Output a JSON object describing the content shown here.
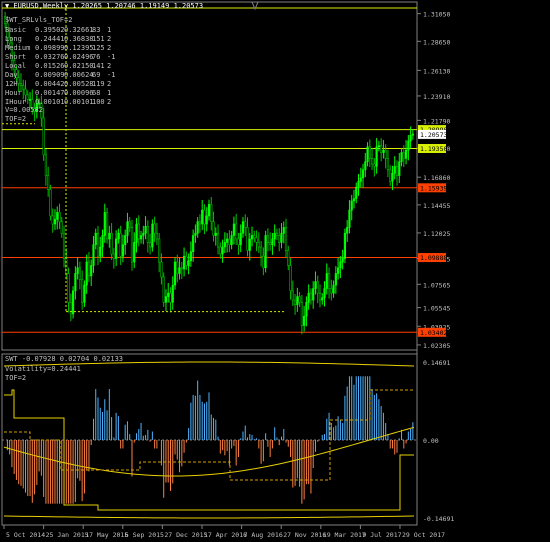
{
  "header": {
    "symbol_line": "▼ EURUSD,Weekly  1.20265 1.20746 1.19149 1.20573",
    "indicator_name": "SWT_SRLvls_TOF=2"
  },
  "stats_table": {
    "rows": [
      {
        "name": "Basic",
        "v1": "0.39502",
        "v2": "0.32661",
        "v3": "83",
        "v4": "1"
      },
      {
        "name": "Long",
        "v1": "0.24441",
        "v2": "0.36838",
        "v3": "151",
        "v4": "2"
      },
      {
        "name": "Medium",
        "v1": "0.09899",
        "v2": "0.12395",
        "v3": "125",
        "v4": "2"
      },
      {
        "name": "Short",
        "v1": "0.03276",
        "v3": "76",
        "v2": "0.02496",
        "v4": "-1"
      },
      {
        "name": "Local",
        "v1": "0.01526",
        "v2": "0.02150",
        "v3": "141",
        "v4": "2"
      },
      {
        "name": "Day",
        "v1": "0.00909",
        "v2": "0.00624",
        "v3": "69",
        "v4": "-1"
      },
      {
        "name": "12H",
        "v1": "0.00442",
        "v2": "0.00528",
        "v3": "119",
        "v4": "2"
      },
      {
        "name": "Hour",
        "v1": "0.00147",
        "v2": "0.00096",
        "v3": "68",
        "v4": "1"
      },
      {
        "name": "IHour",
        "v1": "0.00101",
        "v2": "0.00101",
        "v3": "100",
        "v4": "2"
      }
    ],
    "v_line": "V=0.00582",
    "tof_line": "TOF=2"
  },
  "price_axis": {
    "labels": [
      "1.31050",
      "1.28650",
      "1.26130",
      "1.23910",
      "1.21790",
      "1.19380",
      "1.16860",
      "1.14455",
      "1.12025",
      "1.09805",
      "1.07565",
      "1.05545",
      "1.03925",
      "1.02305"
    ],
    "highlight_labels": [
      {
        "text": "1.20990",
        "color": "#d8f000",
        "text_color": "#000000"
      },
      {
        "text": "1.20573",
        "color": "#ffffff",
        "text_color": "#000000"
      },
      {
        "text": "1.19350",
        "color": "#d8f000",
        "text_color": "#000000"
      },
      {
        "text": "1.15939",
        "color": "#ff4000",
        "text_color": "#000000"
      },
      {
        "text": "1.09888",
        "color": "#ff4000",
        "text_color": "#000000"
      },
      {
        "text": "1.03402",
        "color": "#ff4000",
        "text_color": "#000000"
      }
    ]
  },
  "sub_window": {
    "title": "SWT -0.07928 0.02704 0.02133",
    "volatility": "Volatility=0.24441",
    "tof": "TOF=2",
    "axis_labels": [
      "0.14691",
      "0.00",
      "-0.14691"
    ]
  },
  "time_axis": {
    "labels": [
      "5 Oct 2014",
      "25 Jan 2015",
      "17 May 2015",
      "6 Sep 2015",
      "27 Dec 2015",
      "17 Apr 2016",
      "7 Aug 2016",
      "27 Nov 2016",
      "19 Mar 2017",
      "9 Jul 2017",
      "29 Oct 2017"
    ]
  },
  "colors": {
    "background": "#000000",
    "bull_candle": "#00ff00",
    "bear_candle": "#00c000",
    "support": "#ff4000",
    "resistance": "#d8f000",
    "grid_text": "#c0c0c0",
    "histogram_up": "#4fb4ff",
    "histogram_down": "#ff8040",
    "envelope": "#e8d000"
  },
  "chart_data": {
    "type": "candlestick",
    "symbol": "EURUSD",
    "timeframe": "Weekly",
    "ylim": [
      1.023,
      1.318
    ],
    "levels": [
      1.2099,
      1.1935,
      1.15939,
      1.09888,
      1.03402
    ],
    "closes": [
      1.302,
      1.29,
      1.285,
      1.27,
      1.262,
      1.255,
      1.25,
      1.248,
      1.245,
      1.24,
      1.236,
      1.236,
      1.228,
      1.226,
      1.232,
      1.233,
      1.22,
      1.188,
      1.17,
      1.158,
      1.135,
      1.128,
      1.132,
      1.138,
      1.13,
      1.12,
      1.098,
      1.085,
      1.06,
      1.05,
      1.07,
      1.085,
      1.09,
      1.08,
      1.06,
      1.075,
      1.095,
      1.083,
      1.092,
      1.11,
      1.12,
      1.1,
      1.108,
      1.118,
      1.138,
      1.115,
      1.12,
      1.102,
      1.098,
      1.115,
      1.12,
      1.1,
      1.11,
      1.118,
      1.13,
      1.125,
      1.095,
      1.112,
      1.128,
      1.115,
      1.118,
      1.12,
      1.126,
      1.112,
      1.108,
      1.128,
      1.12,
      1.115,
      1.095,
      1.082,
      1.06,
      1.065,
      1.068,
      1.06,
      1.075,
      1.095,
      1.085,
      1.09,
      1.089,
      1.1,
      1.092,
      1.096,
      1.104,
      1.118,
      1.12,
      1.13,
      1.128,
      1.14,
      1.128,
      1.135,
      1.145,
      1.13,
      1.118,
      1.12,
      1.108,
      1.102,
      1.108,
      1.112,
      1.115,
      1.11,
      1.118,
      1.128,
      1.115,
      1.11,
      1.12,
      1.13,
      1.125,
      1.105,
      1.115,
      1.118,
      1.116,
      1.112,
      1.108,
      1.1,
      1.09,
      1.118,
      1.112,
      1.11,
      1.115,
      1.12,
      1.118,
      1.112,
      1.12,
      1.125,
      1.105,
      1.092,
      1.07,
      1.062,
      1.058,
      1.065,
      1.06,
      1.04,
      1.048,
      1.06,
      1.068,
      1.062,
      1.072,
      1.078,
      1.068,
      1.062,
      1.064,
      1.072,
      1.085,
      1.072,
      1.068,
      1.075,
      1.085,
      1.09,
      1.095,
      1.098,
      1.12,
      1.125,
      1.14,
      1.148,
      1.15,
      1.16,
      1.165,
      1.168,
      1.175,
      1.182,
      1.195,
      1.185,
      1.18,
      1.178,
      1.195,
      1.196,
      1.19,
      1.192,
      1.185,
      1.175,
      1.165,
      1.172,
      1.178,
      1.17,
      1.182,
      1.19,
      1.185,
      1.192,
      1.2,
      1.205,
      1.206
    ]
  }
}
